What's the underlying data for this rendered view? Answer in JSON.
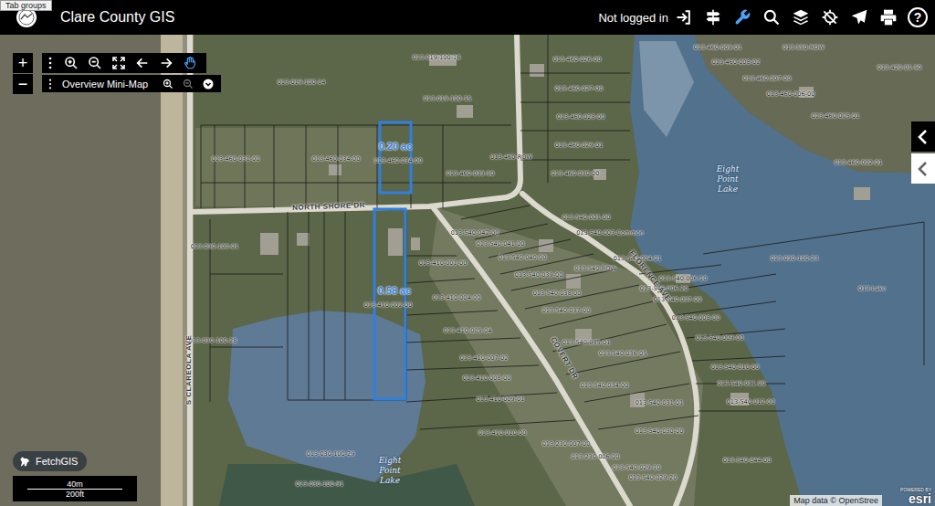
{
  "header": {
    "tooltip": "Tab groups",
    "title": "Clare County GIS",
    "login": "Not logged in",
    "help_glyph": "?"
  },
  "toolbar": [
    {
      "selected": false
    },
    {
      "selected": false
    },
    {
      "selected": true
    },
    {
      "selected": false
    },
    {
      "selected": false
    },
    {
      "selected": false
    },
    {
      "selected": false
    },
    {
      "selected": false
    },
    {
      "selected": false
    }
  ],
  "zoom": {
    "in": "+",
    "out": "−"
  },
  "map_tools": [
    {
      "selected": false
    },
    {
      "selected": false
    },
    {
      "selected": false
    },
    {
      "selected": false
    },
    {
      "selected": false
    },
    {
      "selected": true
    }
  ],
  "mini_map": {
    "label": "Overview Mini-Map",
    "tools": [
      {
        "disabled": false
      },
      {
        "disabled": true
      },
      {
        "disabled": false
      }
    ]
  },
  "side_tabs": [
    {
      "selected": true
    },
    {
      "selected": false
    }
  ],
  "selected_parcels": [
    {
      "area": "0.20 ac",
      "selected": true
    },
    {
      "area": "0.58 ac",
      "selected": true
    }
  ],
  "parcel_labels": [
    "013-019-100-16",
    "013-460-026-00",
    "013-460-009-01",
    "013-460-008-02",
    "013-550-ROW",
    "013-420-01-50",
    "013-460-027-00",
    "013-460-007-00",
    "013-019-100-14",
    "013-019-100-15",
    "013-460-006-00",
    "013-460-028-00",
    "013-460-005-01",
    "013-460-029-01",
    "013-460-031-00",
    "013-460-034-00",
    "013-460-034-00",
    "013-460-ROW",
    "013-460-033-50",
    "013-460-030-00",
    "013-460-002-01",
    "013-540-001-00",
    "013-540-003-Common",
    "013-540-042-00",
    "013-030-100-01",
    "013-540-041-00",
    "013-540-040-00",
    "013-540-004-01",
    "013-410-001-00",
    "013-030-100-23",
    "013-540-ROW",
    "013-540-039-00",
    "013-540-006-10",
    "013-540-006-20",
    "013-Lake",
    "013-540-007-00",
    "013-410-002-00",
    "013-540-038-00",
    "013-410-004-00",
    "013-540-037-00",
    "013-540-008-00",
    "013-030-100-28",
    "013-410-005-04",
    "013-540-035-01",
    "013-540-009-00",
    "013-410-007-02",
    "013-540-036-05",
    "013-540-010-00",
    "013-410-008-00",
    "013-540-034-00",
    "013-540-011-00",
    "013-410-009-01",
    "013-540-031-01",
    "013-540-012-00",
    "013-540-030-00",
    "013-410-010-00",
    "013-230-007-00",
    "013-030-100-29",
    "013-230-006-00",
    "013-540-044-00",
    "013-540-029-10",
    "013-540-029-20",
    "013-030-100-91"
  ],
  "roads": [
    "NORTH SHORE DR",
    "FLORENCE AVE",
    "COVERT DR",
    "S CLAREOLA AVE"
  ],
  "lakes": [
    "Eight Point Lake",
    "Eight Point Lake"
  ],
  "scale": {
    "metric": "40m",
    "imperial": "200ft"
  },
  "badge": "FetchGIS",
  "attribution": "Map data © OpenStree",
  "esri": {
    "powered": "POWERED BY",
    "brand": "esri"
  }
}
